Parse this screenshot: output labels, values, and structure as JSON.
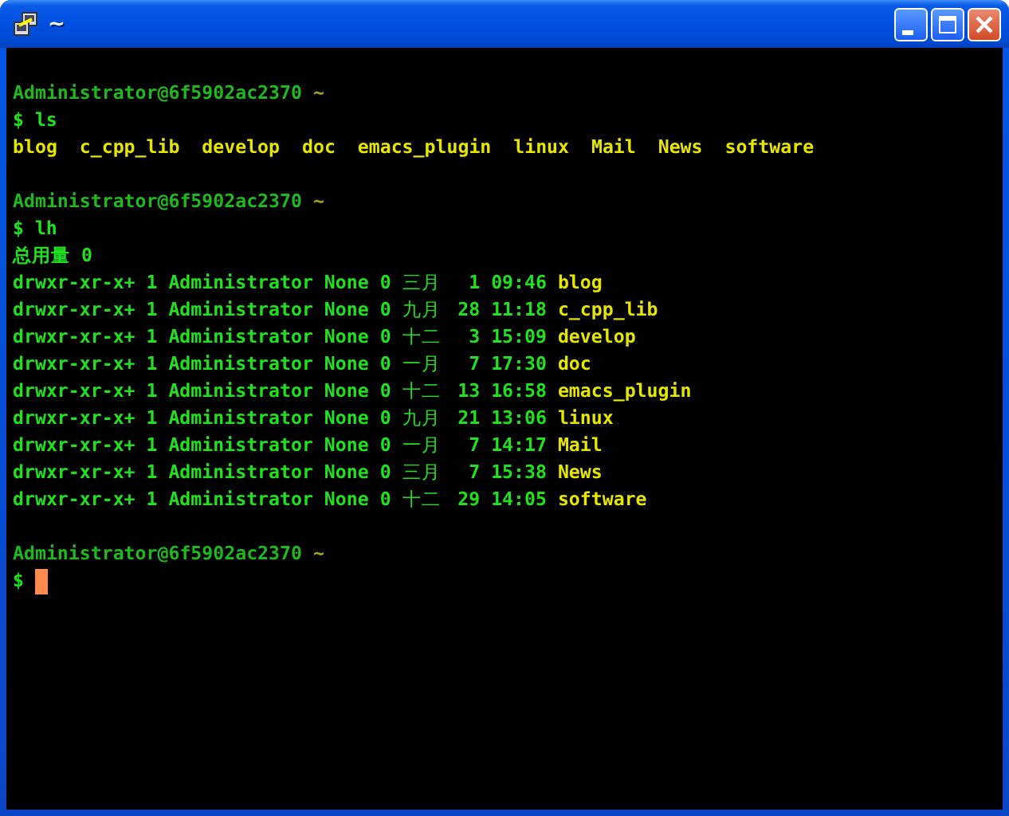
{
  "window": {
    "title": "~"
  },
  "terminal": {
    "lines": [
      {
        "kind": "blank"
      },
      {
        "kind": "prompt",
        "user_host": "Administrator@6f5902ac2370",
        "cwd": "~"
      },
      {
        "kind": "command",
        "sign": "$",
        "text": "ls"
      },
      {
        "kind": "ls_output",
        "entries": [
          "blog",
          "c_cpp_lib",
          "develop",
          "doc",
          "emacs_plugin",
          "linux",
          "Mail",
          "News",
          "software"
        ]
      },
      {
        "kind": "blank"
      },
      {
        "kind": "prompt",
        "user_host": "Administrator@6f5902ac2370",
        "cwd": "~"
      },
      {
        "kind": "command",
        "sign": "$",
        "text": "lh"
      },
      {
        "kind": "text",
        "text": "总用量 0"
      },
      {
        "kind": "listing",
        "perms": "drwxr-xr-x+",
        "links": "1",
        "owner": "Administrator",
        "group": "None",
        "size": "0",
        "month": "三月",
        "day": "1",
        "time": "09:46",
        "name": "blog"
      },
      {
        "kind": "listing",
        "perms": "drwxr-xr-x+",
        "links": "1",
        "owner": "Administrator",
        "group": "None",
        "size": "0",
        "month": "九月",
        "day": "28",
        "time": "11:18",
        "name": "c_cpp_lib"
      },
      {
        "kind": "listing",
        "perms": "drwxr-xr-x+",
        "links": "1",
        "owner": "Administrator",
        "group": "None",
        "size": "0",
        "month": "十二",
        "day": "3",
        "time": "15:09",
        "name": "develop"
      },
      {
        "kind": "listing",
        "perms": "drwxr-xr-x+",
        "links": "1",
        "owner": "Administrator",
        "group": "None",
        "size": "0",
        "month": "一月",
        "day": "7",
        "time": "17:30",
        "name": "doc"
      },
      {
        "kind": "listing",
        "perms": "drwxr-xr-x+",
        "links": "1",
        "owner": "Administrator",
        "group": "None",
        "size": "0",
        "month": "十二",
        "day": "13",
        "time": "16:58",
        "name": "emacs_plugin"
      },
      {
        "kind": "listing",
        "perms": "drwxr-xr-x+",
        "links": "1",
        "owner": "Administrator",
        "group": "None",
        "size": "0",
        "month": "九月",
        "day": "21",
        "time": "13:06",
        "name": "linux"
      },
      {
        "kind": "listing",
        "perms": "drwxr-xr-x+",
        "links": "1",
        "owner": "Administrator",
        "group": "None",
        "size": "0",
        "month": "一月",
        "day": "7",
        "time": "14:17",
        "name": "Mail"
      },
      {
        "kind": "listing",
        "perms": "drwxr-xr-x+",
        "links": "1",
        "owner": "Administrator",
        "group": "None",
        "size": "0",
        "month": "三月",
        "day": "7",
        "time": "15:38",
        "name": "News"
      },
      {
        "kind": "listing",
        "perms": "drwxr-xr-x+",
        "links": "1",
        "owner": "Administrator",
        "group": "None",
        "size": "0",
        "month": "十二",
        "day": "29",
        "time": "14:05",
        "name": "software"
      },
      {
        "kind": "blank"
      },
      {
        "kind": "prompt",
        "user_host": "Administrator@6f5902ac2370",
        "cwd": "~"
      },
      {
        "kind": "cursor_line",
        "sign": "$"
      }
    ]
  }
}
